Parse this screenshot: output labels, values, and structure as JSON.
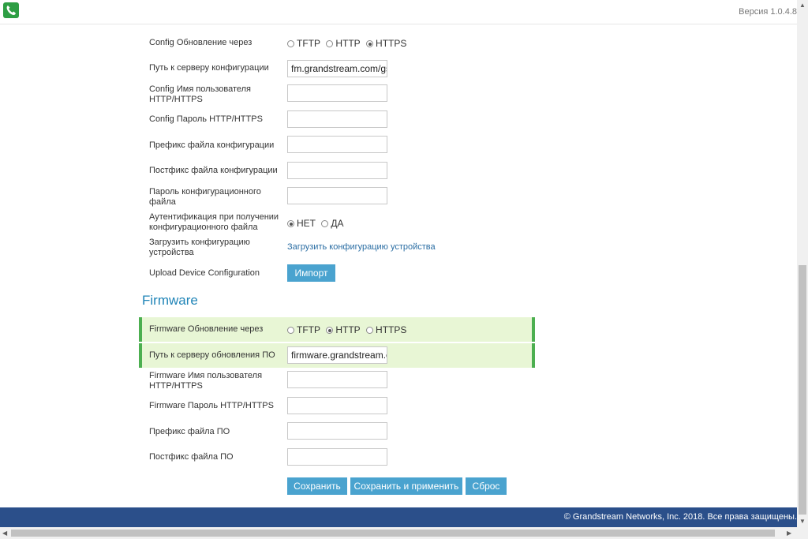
{
  "header": {
    "version": "Версия 1.0.4.8"
  },
  "config": {
    "upgrade_via": {
      "label": "Config Обновление через",
      "options": [
        "TFTP",
        "HTTP",
        "HTTPS"
      ],
      "selected": "HTTPS"
    },
    "server_path": {
      "label": "Путь к серверу конфигурации",
      "value": "fm.grandstream.com/gs"
    },
    "username": {
      "label": "Config Имя пользователя HTTP/HTTPS",
      "value": ""
    },
    "password": {
      "label": "Config Пароль HTTP/HTTPS",
      "value": ""
    },
    "prefix": {
      "label": "Префикс файла конфигурации",
      "value": ""
    },
    "postfix": {
      "label": "Постфикс файла конфигурации",
      "value": ""
    },
    "file_password": {
      "label": "Пароль конфигурационного файла",
      "value": ""
    },
    "auth": {
      "label": "Аутентификация при получении конфигурационного файла",
      "options": [
        "НЕТ",
        "ДА"
      ],
      "selected": "НЕТ"
    },
    "download": {
      "label": "Загрузить конфигурацию устройства",
      "link": "Загрузить конфигурацию устройства"
    },
    "upload": {
      "label": "Upload Device Configuration",
      "button": "Импорт"
    }
  },
  "firmware": {
    "title": "Firmware",
    "upgrade_via": {
      "label": "Firmware Обновление через",
      "options": [
        "TFTP",
        "HTTP",
        "HTTPS"
      ],
      "selected": "HTTP"
    },
    "server_path": {
      "label": "Путь к серверу обновления ПО",
      "value": "firmware.grandstream.com"
    },
    "username": {
      "label": "Firmware Имя пользователя HTTP/HTTPS",
      "value": ""
    },
    "password": {
      "label": "Firmware Пароль HTTP/HTTPS",
      "value": ""
    },
    "prefix": {
      "label": "Префикс файла ПО",
      "value": ""
    },
    "postfix": {
      "label": "Постфикс файла ПО",
      "value": ""
    }
  },
  "actions": {
    "save": "Сохранить",
    "save_apply": "Сохранить и применить",
    "reset": "Сброс"
  },
  "footer": {
    "copyright": "© Grandstream Networks, Inc. 2018. Все права защищены."
  },
  "colors": {
    "accent": "#4aa3cf",
    "highlight": "#e8f6d5",
    "highlight_border": "#4caf50",
    "footer": "#2b4f8a",
    "title": "#1f84b7"
  },
  "icons": {
    "logo": "phone-handset-icon"
  }
}
